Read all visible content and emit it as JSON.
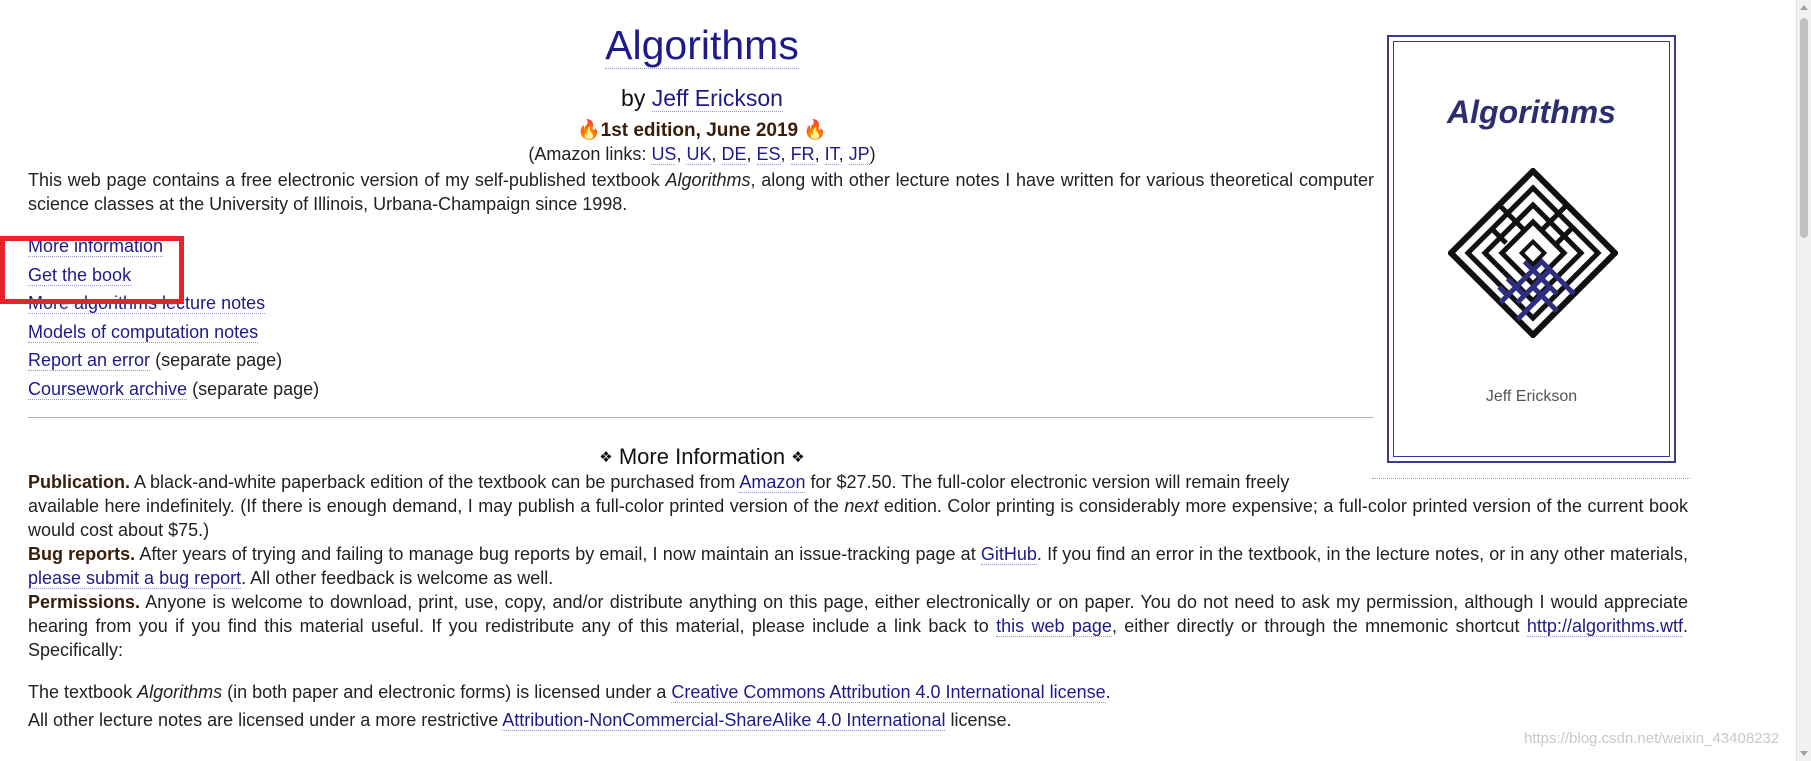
{
  "header": {
    "title": "Algorithms",
    "by": "by",
    "author": "Jeff Erickson",
    "edition": "1st edition, June 2019",
    "amazon_prefix": "(Amazon links:",
    "amazon_links": [
      "US",
      "UK",
      "DE",
      "ES",
      "FR",
      "IT",
      "JP"
    ],
    "amazon_suffix": ")"
  },
  "intro": {
    "before": "This web page contains a free electronic version of my self-published textbook",
    "book_title": "Algorithms",
    "after": ", along with other lecture notes I have written for various theoretical computer science classes at the University of Illinois, Urbana-Champaign since 1998."
  },
  "nav": [
    {
      "label": "More information",
      "note": ""
    },
    {
      "label": "Get the book",
      "note": ""
    },
    {
      "label": "More algorithms lecture notes",
      "note": ""
    },
    {
      "label": "Models of computation notes",
      "note": ""
    },
    {
      "label": "Report an error",
      "note": "(separate page)"
    },
    {
      "label": "Coursework archive",
      "note": "(separate page)"
    }
  ],
  "section": {
    "heading": "More Information"
  },
  "publication": {
    "label": "Publication.",
    "t1": "A black-and-white paperback edition of the textbook can be purchased from",
    "link": "Amazon",
    "t2": "for $27.50. The full-color electronic version will remain freely",
    "t3": "available here indefinitely. (If there is enough demand, I may publish a full-color printed version of the",
    "next": "next",
    "t4": "edition. Color printing is considerably more expensive; a full-color printed version of the current book would cost about $75.)"
  },
  "bugs": {
    "label": "Bug reports.",
    "t1": "After years of trying and failing to manage bug reports by email, I now maintain an issue-tracking page at",
    "github": "GitHub",
    "t2": ". If you find an error in the textbook, in the lecture notes, or in any other materials,",
    "submit": "please submit a bug report",
    "t3": ". All other feedback is welcome as well."
  },
  "permissions": {
    "label": "Permissions.",
    "t1": "Anyone is welcome to download, print, use, copy, and/or distribute anything on this page, either electronically or on paper. You do not need to ask my permission, although I would appreciate hearing from you if you find this material useful. If you redistribute any of this material, please include a link back to",
    "page_link": "this web page",
    "t2": ", either directly or through the mnemonic shortcut",
    "shortcut": "http://algorithms.wtf",
    "t3": ". Specifically:"
  },
  "license1": {
    "t1": "The textbook",
    "book": "Algorithms",
    "t2": "(in both paper and electronic forms) is licensed under a",
    "link": "Creative Commons Attribution 4.0 International license",
    "t3": "."
  },
  "license2": {
    "t1": "All other lecture notes are licensed under a more restrictive",
    "link": "Attribution-NonCommercial-ShareAlike 4.0 International",
    "t2": "license."
  },
  "cover": {
    "title": "Algorithms",
    "author": "Jeff Erickson"
  },
  "watermark": "https://blog.csdn.net/weixin_43408232",
  "colors": {
    "link": "#1f1a8c",
    "highlight_box": "#e8212a",
    "cover_accent": "#2e2e6e"
  }
}
